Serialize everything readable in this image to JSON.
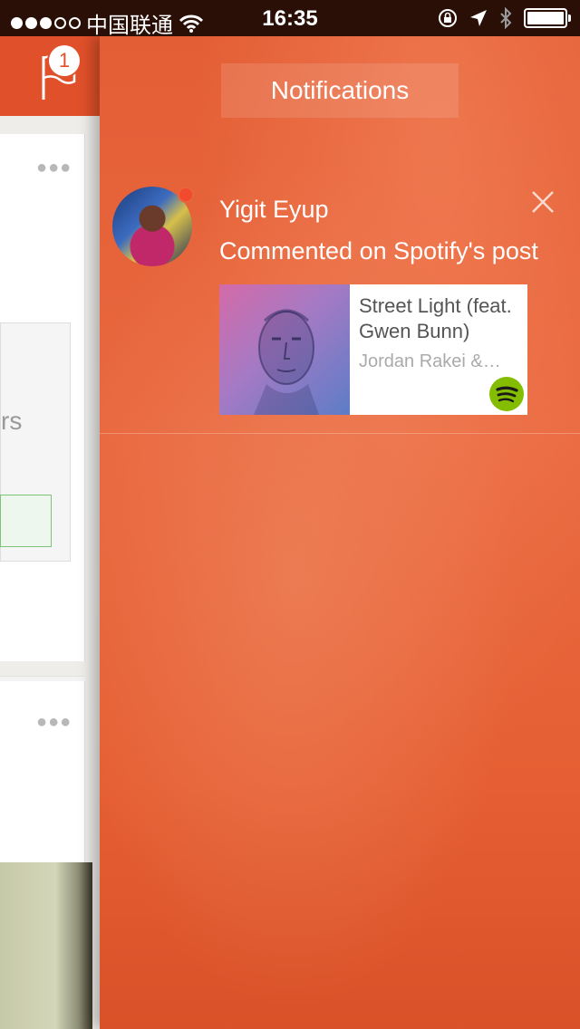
{
  "status_bar": {
    "carrier": "中国联通",
    "time": "16:35",
    "signal_strength_bars": 3,
    "signal_total_bars": 5
  },
  "main": {
    "notification_badge_count": "1",
    "partial_text": "rs"
  },
  "notifications": {
    "title": "Notifications",
    "items": [
      {
        "user_name": "Yigit Eyup",
        "action": "Commented on Spotify's post",
        "unread": true,
        "track": {
          "title": "Street Light (feat. Gwen Bunn)",
          "artist": "Jordan Rakei &…",
          "service_icon": "spotify-icon"
        }
      }
    ]
  },
  "colors": {
    "accent": "#e0502a",
    "panel": "#e8653d",
    "unread_dot": "#f24a2e",
    "spotify_green": "#84bd00"
  }
}
